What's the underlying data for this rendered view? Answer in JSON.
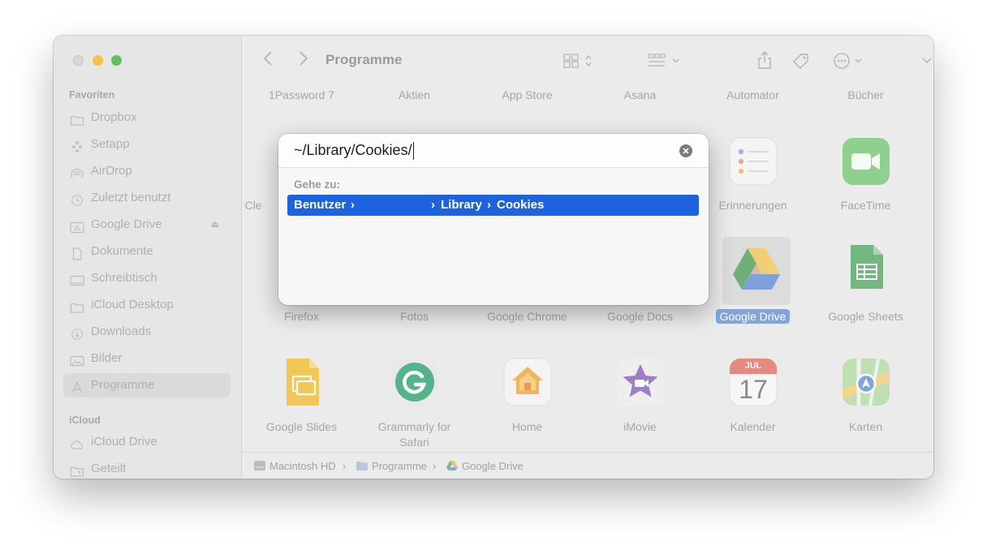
{
  "window": {
    "toolbar": {
      "title": "Programme"
    },
    "sidebar": {
      "favorites_header": "Favoriten",
      "favorites": [
        {
          "label": "Dropbox",
          "icon": "folder-icon"
        },
        {
          "label": "Setapp",
          "icon": "setapp-icon"
        },
        {
          "label": "AirDrop",
          "icon": "airdrop-icon"
        },
        {
          "label": "Zuletzt benutzt",
          "icon": "clock-icon"
        },
        {
          "label": "Google Drive",
          "icon": "drive-folder-icon"
        },
        {
          "label": "Dokumente",
          "icon": "document-icon"
        },
        {
          "label": "Schreibtisch",
          "icon": "desktop-icon"
        },
        {
          "label": "iCloud Desktop",
          "icon": "folder-icon"
        },
        {
          "label": "Downloads",
          "icon": "download-icon"
        },
        {
          "label": "Bilder",
          "icon": "photo-icon"
        },
        {
          "label": "Programme",
          "icon": "apps-icon"
        }
      ],
      "icloud_header": "iCloud",
      "icloud": [
        {
          "label": "iCloud Drive",
          "icon": "cloud-icon"
        },
        {
          "label": "Geteilt",
          "icon": "shared-folder-icon"
        }
      ]
    },
    "apps": {
      "row1": [
        "1Password 7",
        "Aktien",
        "App Store",
        "Asana",
        "Automator",
        "Bücher"
      ],
      "row2_partial": "Cle",
      "row2": [
        "Erinnerungen",
        "FaceTime"
      ],
      "row3": [
        "Firefox",
        "Fotos",
        "Google Chrome",
        "Google Docs",
        "Google Drive",
        "Google Sheets"
      ],
      "row4": [
        "Google Slides",
        "Grammarly for Safari",
        "Home",
        "iMovie",
        "Kalender",
        "Karten"
      ],
      "row4_line1": "Grammarly for",
      "row4_line2": "Safari",
      "calendar_month": "JUL",
      "calendar_day": "17",
      "selected": "Google Drive"
    },
    "statusbar": {
      "path": [
        "Macintosh HD",
        "Programme",
        "Google Drive"
      ]
    }
  },
  "dialog": {
    "input_value": "~/Library/Cookies/",
    "goto_label": "Gehe zu:",
    "suggestion": [
      "Benutzer",
      "Library",
      "Cookies"
    ]
  },
  "colors": {
    "accent": "#1d63e0",
    "selection_dimmed": "#7fa6dc",
    "traffic_min": "#f2c444",
    "traffic_max": "#5ec35a"
  }
}
